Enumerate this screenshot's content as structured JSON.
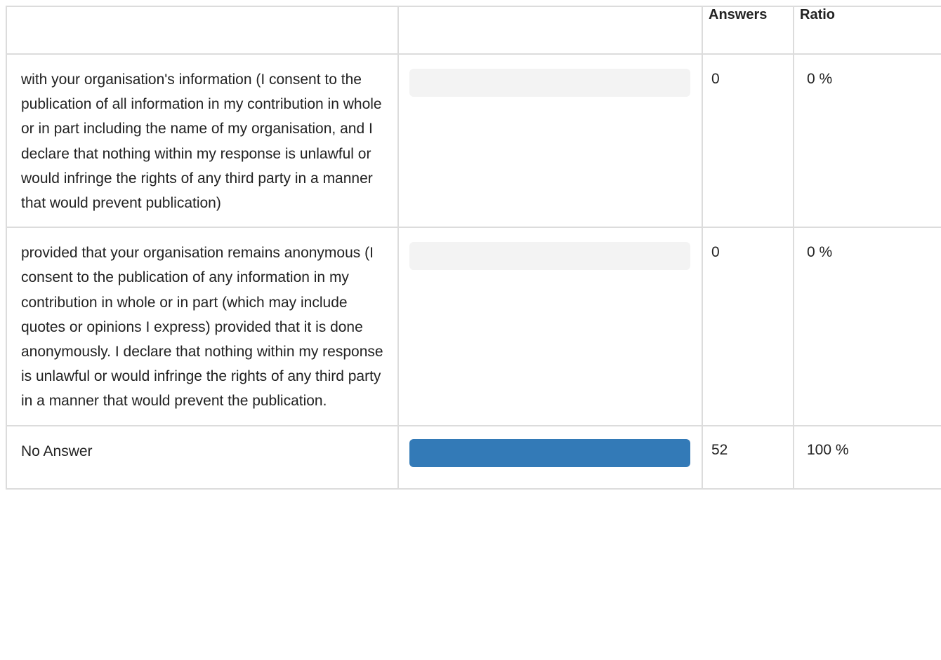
{
  "table": {
    "headers": {
      "label": "",
      "bar": "",
      "answers": "Answers",
      "ratio": "Ratio"
    },
    "rows": [
      {
        "label": "with your organisation's information (I consent to the publication of all information in my contribution in whole or in part including the name of my organisation, and I declare that nothing within my response is unlawful or would infringe the rights of any third party in a manner that would prevent publication)",
        "answers": "0",
        "ratio": "0 %",
        "fraction": 0
      },
      {
        "label": "provided that your organisation remains anonymous (I consent to the publication of any information in my contribution in whole or in part (which may include quotes or opinions I express) provided that it is done anonymously. I declare that nothing within my response is unlawful or would infringe the rights of any third party in a manner that would prevent the publication.",
        "answers": "0",
        "ratio": "0 %",
        "fraction": 0
      },
      {
        "label": "No Answer",
        "answers": "52",
        "ratio": "100 %",
        "fraction": 1
      }
    ]
  },
  "colors": {
    "bar_fill": "#337ab7",
    "bar_track": "#f3f3f3",
    "border": "#dcdcdc"
  }
}
